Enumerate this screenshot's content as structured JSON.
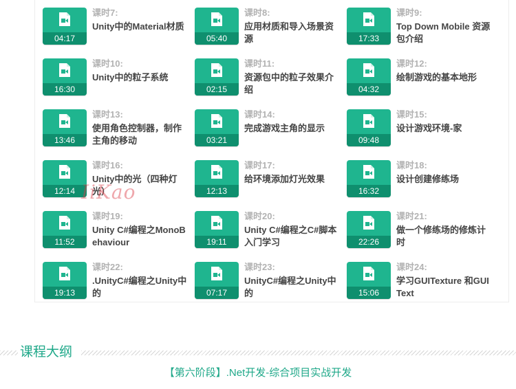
{
  "lessons": [
    {
      "num": "课时7:",
      "title": "Unity中的Material材质",
      "duration": "04:17"
    },
    {
      "num": "课时8:",
      "title": "应用材质和导入场景资源",
      "duration": "05:40"
    },
    {
      "num": "课时9:",
      "title": "Top Down Mobile 资源包介绍",
      "duration": "17:33"
    },
    {
      "num": "课时10:",
      "title": "Unity中的粒子系统",
      "duration": "16:30"
    },
    {
      "num": "课时11:",
      "title": "资源包中的粒子效果介绍",
      "duration": "02:15"
    },
    {
      "num": "课时12:",
      "title": "绘制游戏的基本地形",
      "duration": "04:32"
    },
    {
      "num": "课时13:",
      "title": "使用角色控制器，制作主角的移动",
      "duration": "13:46"
    },
    {
      "num": "课时14:",
      "title": "完成游戏主角的显示",
      "duration": "03:21"
    },
    {
      "num": "课时15:",
      "title": "设计游戏环境-家",
      "duration": "09:48"
    },
    {
      "num": "课时16:",
      "title": "Unity中的光（四种灯光）",
      "duration": "12:14"
    },
    {
      "num": "课时17:",
      "title": "给环境添加灯光效果",
      "duration": "12:13"
    },
    {
      "num": "课时18:",
      "title": "设计创建修练场",
      "duration": "16:32"
    },
    {
      "num": "课时19:",
      "title": "Unity C#编程之MonoBehaviour",
      "duration": "11:52"
    },
    {
      "num": "课时20:",
      "title": "Unity C#编程之C#脚本入门学习",
      "duration": "19:11"
    },
    {
      "num": "课时21:",
      "title": "做一个修练场的修炼计时",
      "duration": "22:26"
    },
    {
      "num": "课时22:",
      "title": ".UnityC#编程之Unity中的",
      "duration": "19:13"
    },
    {
      "num": "课时23:",
      "title": "UnityC#编程之Unity中的",
      "duration": "07:17"
    },
    {
      "num": "课时24:",
      "title": "学习GUITexture 和GUIText",
      "duration": "15:06"
    }
  ],
  "watermark": "IiKao",
  "outline": {
    "title": "课程大纲",
    "stage": "【第六阶段】.Net开发-综合项目实战开发"
  },
  "colors": {
    "accent": "#1fb58f",
    "duration_bar": "#0f8f6e",
    "lesson_number": "#b2b2b2",
    "lesson_title": "#444444",
    "outline_text": "#1fa889"
  },
  "icons": {
    "thumbnail": "video-file-icon"
  }
}
